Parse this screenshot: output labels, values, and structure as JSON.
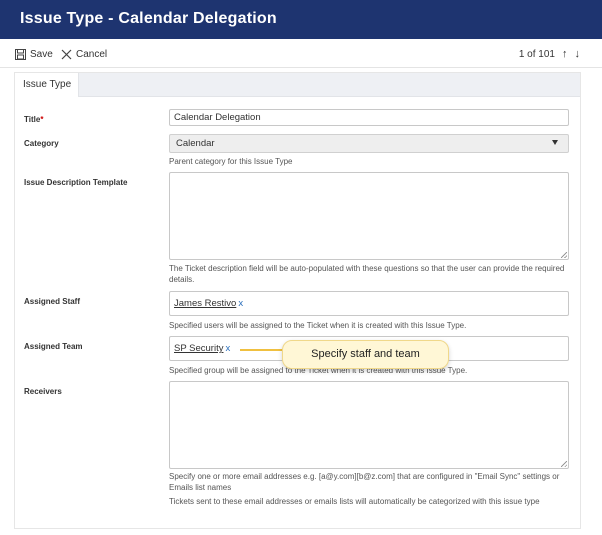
{
  "window": {
    "title": "Issue Type - Calendar Delegation"
  },
  "toolbar": {
    "save_label": "Save",
    "cancel_label": "Cancel",
    "pager_text": "1 of 101"
  },
  "tabs": [
    {
      "label": "Issue Type"
    }
  ],
  "form": {
    "title": {
      "label": "Title",
      "value": "Calendar Delegation"
    },
    "category": {
      "label": "Category",
      "value": "Calendar",
      "help": "Parent category for this Issue Type"
    },
    "description_template": {
      "label": "Issue Description Template",
      "value": "",
      "help": "The Ticket description field will be auto-populated with these questions so that the user can provide the required details."
    },
    "assigned_staff": {
      "label": "Assigned Staff",
      "tags": [
        "James Restivo"
      ],
      "help": "Specified users will be assigned to the Ticket when it is created with this Issue Type."
    },
    "assigned_team": {
      "label": "Assigned Team",
      "tags": [
        "SP Security"
      ],
      "help": "Specified group will be assigned to the Ticket when it is created with this Issue Type."
    },
    "receivers": {
      "label": "Receivers",
      "value": "",
      "help_1": "Specify one or more email addresses e.g. [a@y.com][b@z.com] that are configured in \"Email Sync\" settings or Emails list names",
      "help_2": "Tickets sent to these email addresses or emails lists will automatically be categorized with this issue type"
    }
  },
  "tag_remove_glyph": "x",
  "callout": {
    "text": "Specify staff and team"
  },
  "icons": {
    "save": "floppy-disk-icon",
    "cancel": "close-icon",
    "up": "arrow-up-icon",
    "down": "arrow-down-icon"
  }
}
